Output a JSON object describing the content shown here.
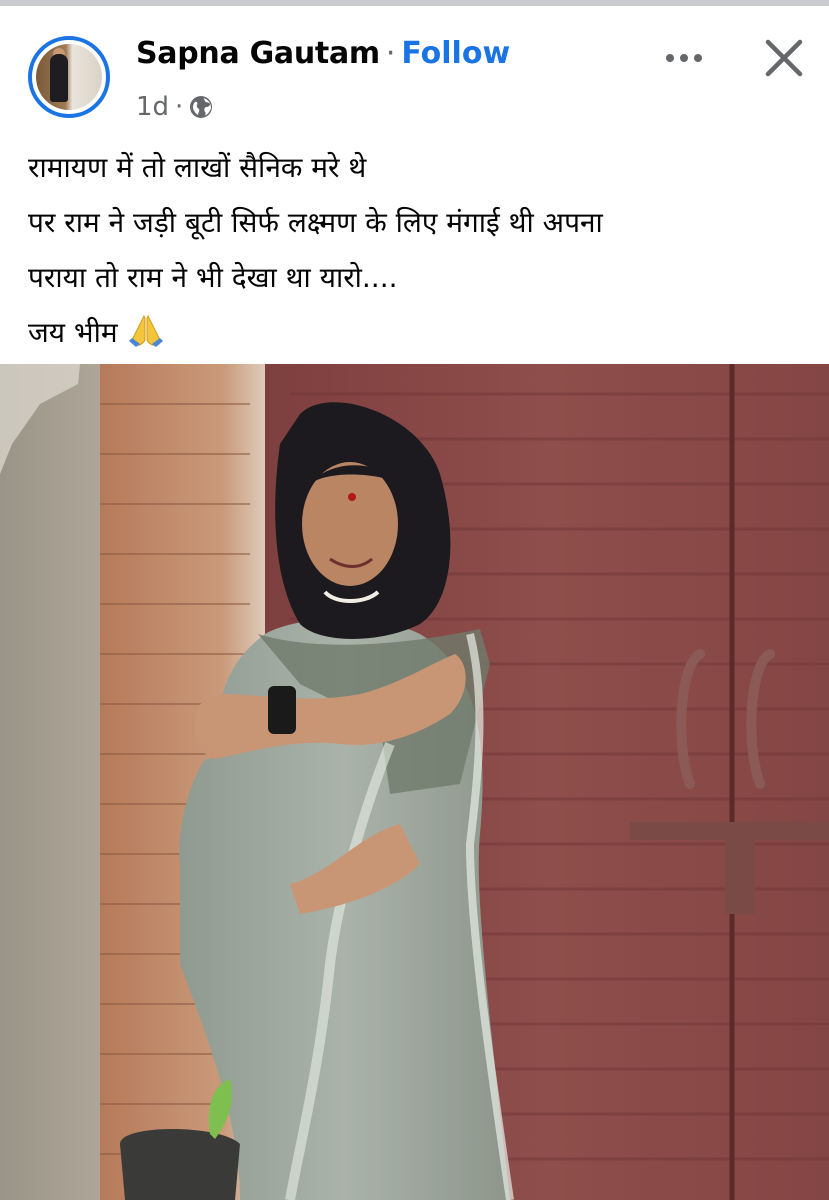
{
  "post": {
    "author": "Sapna Gautam",
    "separator": "·",
    "follow_label": "Follow",
    "timestamp": "1d",
    "meta_separator": "·",
    "audience_icon": "globe-icon",
    "more_icon": "more-horizontal-icon",
    "close_icon": "close-icon",
    "text_lines": [
      "रामायण में तो लाखों सैनिक मरे थे",
      "पर राम ने जड़ी बूटी सिर्फ लक्ष्मण के लिए मंगाई थी अपना",
      "पराया तो राम ने भी देखा था यारो....",
      "जय भीम"
    ],
    "text_emoji": "folded-hands-icon"
  },
  "colors": {
    "link": "#1b74e4",
    "text": "#050505",
    "muted": "#65676b",
    "door": "#8a4b48"
  }
}
